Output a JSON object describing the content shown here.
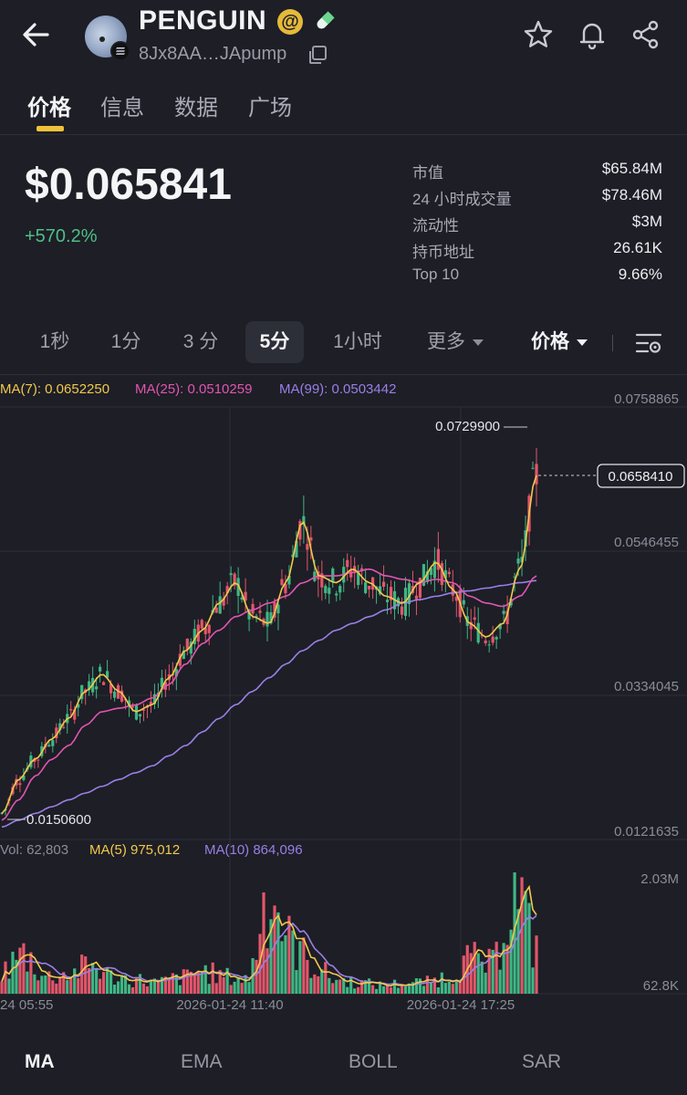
{
  "header": {
    "token_name": "PENGUIN",
    "at_symbol": "@",
    "address": "8Jx8AA…JApump",
    "icons": [
      "back-arrow-icon",
      "solana-icon",
      "pill-icon",
      "copy-icon",
      "star-icon",
      "bell-icon",
      "share-icon"
    ]
  },
  "tabs": [
    {
      "label": "价格",
      "active": true
    },
    {
      "label": "信息",
      "active": false
    },
    {
      "label": "数据",
      "active": false
    },
    {
      "label": "广场",
      "active": false
    }
  ],
  "price": {
    "value": "$0.065841",
    "change": "+570.2%"
  },
  "stats": [
    {
      "label": "市值",
      "value": "$65.84M"
    },
    {
      "label": "24 小时成交量",
      "value": "$78.46M"
    },
    {
      "label": "流动性",
      "value": "$3M"
    },
    {
      "label": "持币地址",
      "value": "26.61K"
    },
    {
      "label": "Top 10",
      "value": "9.66%"
    }
  ],
  "timeframes": [
    {
      "label": "1秒",
      "active": false
    },
    {
      "label": "1分",
      "active": false
    },
    {
      "label": "3 分",
      "active": false
    },
    {
      "label": "5分",
      "active": true
    },
    {
      "label": "1小时",
      "active": false
    },
    {
      "label": "更多",
      "active": false
    }
  ],
  "price_selector": "价格",
  "chart": {
    "ma_legend": {
      "ma7": "MA(7): 0.0652250",
      "ma25": "MA(25): 0.0510259",
      "ma99": "MA(99): 0.0503442"
    },
    "y_ticks": [
      "0.0758865",
      "0.0546455",
      "0.0334045",
      "0.0121635"
    ],
    "high_label": "0.0729900",
    "low_label": "0.0150600",
    "current_price_label": "0.0658410",
    "vol_legend": {
      "vol": "Vol: 62,803",
      "ma5": "MA(5) 975,012",
      "ma10": "MA(10) 864,096"
    },
    "vol_ticks": [
      "2.03M",
      "62.8K"
    ],
    "time_ticks": [
      "24 05:55",
      "2026-01-24 11:40",
      "2026-01-24 17:25"
    ],
    "colors": {
      "up": "#3fb684",
      "down": "#e2566a",
      "ma7": "#f2c94c",
      "ma25": "#e255b1",
      "ma99": "#9b7fe6",
      "ma5_vol": "#f2c94c",
      "ma10_vol": "#9b7fe6"
    }
  },
  "chart_data": {
    "type": "line",
    "series": [
      {
        "name": "MA(7)",
        "values": [
          0.016,
          0.021,
          0.024,
          0.027,
          0.03,
          0.034,
          0.0365,
          0.034,
          0.031,
          0.032,
          0.036,
          0.04,
          0.043,
          0.047,
          0.05,
          0.045,
          0.044,
          0.05,
          0.059,
          0.051,
          0.05,
          0.052,
          0.05,
          0.048,
          0.047,
          0.05,
          0.053,
          0.049,
          0.044,
          0.042,
          0.044,
          0.052,
          0.0658
        ]
      },
      {
        "name": "MA(25)",
        "values": [
          0.015,
          0.018,
          0.0215,
          0.024,
          0.026,
          0.029,
          0.031,
          0.0315,
          0.032,
          0.033,
          0.035,
          0.038,
          0.041,
          0.043,
          0.045,
          0.046,
          0.047,
          0.048,
          0.05,
          0.051,
          0.051,
          0.0515,
          0.052,
          0.051,
          0.0505,
          0.05,
          0.0505,
          0.05,
          0.048,
          0.047,
          0.0465,
          0.048,
          0.051
        ]
      },
      {
        "name": "MA(99)",
        "values": [
          0.014,
          0.015,
          0.016,
          0.017,
          0.018,
          0.019,
          0.02,
          0.021,
          0.022,
          0.023,
          0.0245,
          0.026,
          0.028,
          0.03,
          0.032,
          0.034,
          0.036,
          0.038,
          0.04,
          0.0415,
          0.043,
          0.044,
          0.045,
          0.046,
          0.047,
          0.0475,
          0.048,
          0.0485,
          0.0488,
          0.0492,
          0.0496,
          0.05,
          0.0503
        ]
      }
    ],
    "high": 0.07299,
    "low": 0.01506,
    "current": 0.065841,
    "ylim": [
      0.0121635,
      0.0758865
    ],
    "volume_ylim": [
      62800,
      2030000
    ]
  },
  "bottom_tabs": [
    {
      "label": "MA",
      "active": true
    },
    {
      "label": "EMA",
      "active": false
    },
    {
      "label": "BOLL",
      "active": false
    },
    {
      "label": "SAR",
      "active": false
    }
  ]
}
